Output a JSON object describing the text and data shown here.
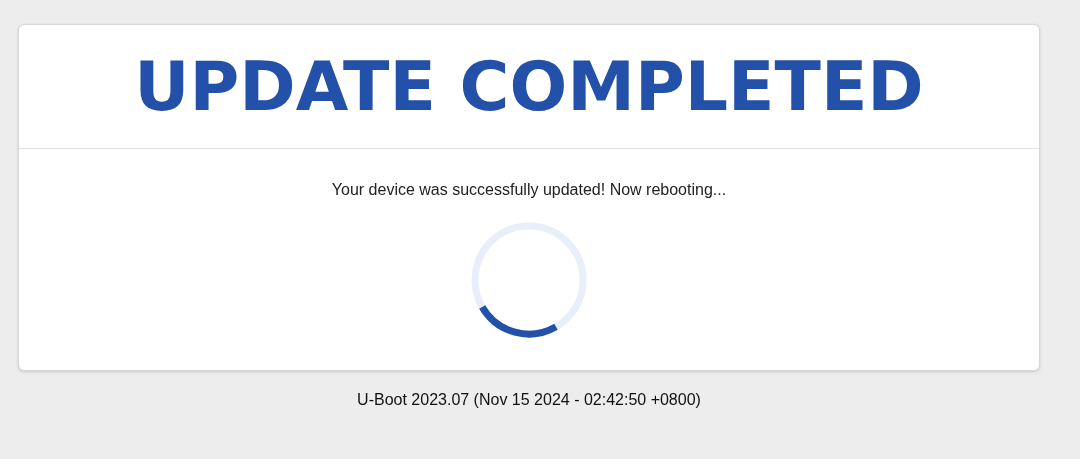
{
  "card": {
    "title": "UPDATE COMPLETED",
    "message": "Your device was successfully updated! Now rebooting..."
  },
  "footer": "U-Boot 2023.07 (Nov 15 2024 - 02:42:50 +0800)"
}
